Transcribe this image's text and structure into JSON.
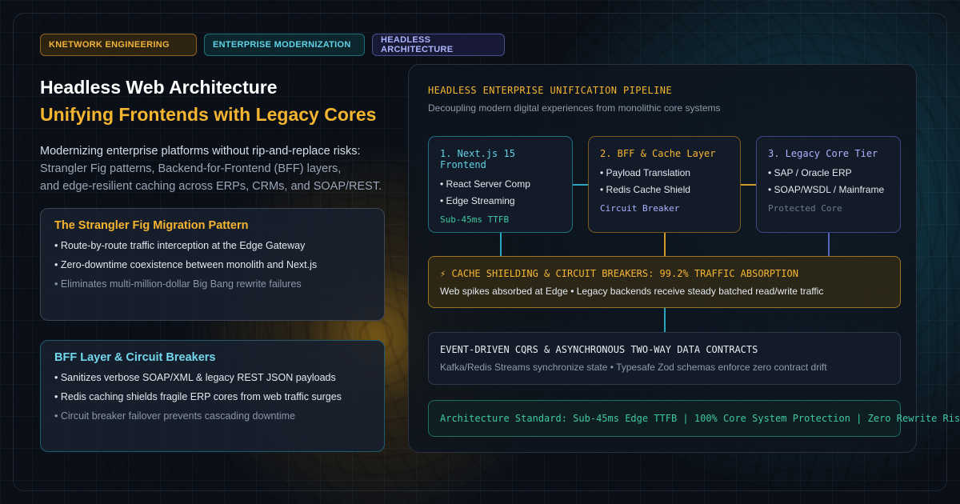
{
  "tags": [
    "KNETWORK ENGINEERING",
    "ENTERPRISE MODERNIZATION",
    "HEADLESS ARCHITECTURE"
  ],
  "heading": {
    "title": "Headless Web Architecture",
    "subtitle": "Unifying Frontends with Legacy Cores"
  },
  "intro": {
    "line1": "Modernizing enterprise platforms without rip-and-replace risks:",
    "line2": "Strangler Fig patterns, Backend-for-Frontend (BFF) layers,",
    "line3": "and edge-resilient caching across ERPs, CRMs, and SOAP/REST."
  },
  "cards": [
    {
      "title": "The Strangler Fig Migration Pattern",
      "items": [
        "• Route-by-route traffic interception at the Edge Gateway",
        "• Zero-downtime coexistence between monolith and Next.js",
        "• Eliminates multi-million-dollar Big Bang rewrite failures"
      ]
    },
    {
      "title": "BFF Layer & Circuit Breakers",
      "items": [
        "• Sanitizes verbose SOAP/XML & legacy REST JSON payloads",
        "• Redis caching shields fragile ERP cores from web traffic surges",
        "• Circuit breaker failover prevents cascading downtime"
      ]
    }
  ],
  "pipeline": {
    "title": "HEADLESS ENTERPRISE UNIFICATION PIPELINE",
    "subtitle": "Decoupling modern digital experiences from monolithic core systems",
    "nodes": [
      {
        "title": "1. Next.js 15 Frontend",
        "items": [
          "• React Server Comp",
          "• Edge Streaming"
        ],
        "footer": "Sub-45ms TTFB"
      },
      {
        "title": "2. BFF & Cache Layer",
        "items": [
          "• Payload Translation",
          "• Redis Cache Shield"
        ],
        "footer": "Circuit Breaker"
      },
      {
        "title": "3. Legacy Core Tier",
        "items": [
          "• SAP / Oracle ERP",
          "• SOAP/WSDL / Mainframe"
        ],
        "footer": "Protected Core"
      }
    ],
    "cache": {
      "title": "⚡ CACHE SHIELDING & CIRCUIT BREAKERS: 99.2% TRAFFIC ABSORPTION",
      "subtitle": "Web spikes absorbed at Edge • Legacy backends receive steady batched read/write traffic"
    },
    "event": {
      "title": "EVENT-DRIVEN CQRS & ASYNCHRONOUS TWO-WAY DATA CONTRACTS",
      "subtitle": "Kafka/Redis Streams synchronize state • Typesafe Zod schemas enforce zero contract drift"
    },
    "standard": "Architecture Standard: Sub-45ms Edge TTFB | 100% Core System Protection | Zero Rewrite Risk"
  },
  "colors": {
    "accent_gold": "#f5b530",
    "accent_cyan": "#5fd3e6",
    "accent_violet": "#aab4ff",
    "accent_green": "#3fc7a4",
    "background": "#0b1018"
  }
}
